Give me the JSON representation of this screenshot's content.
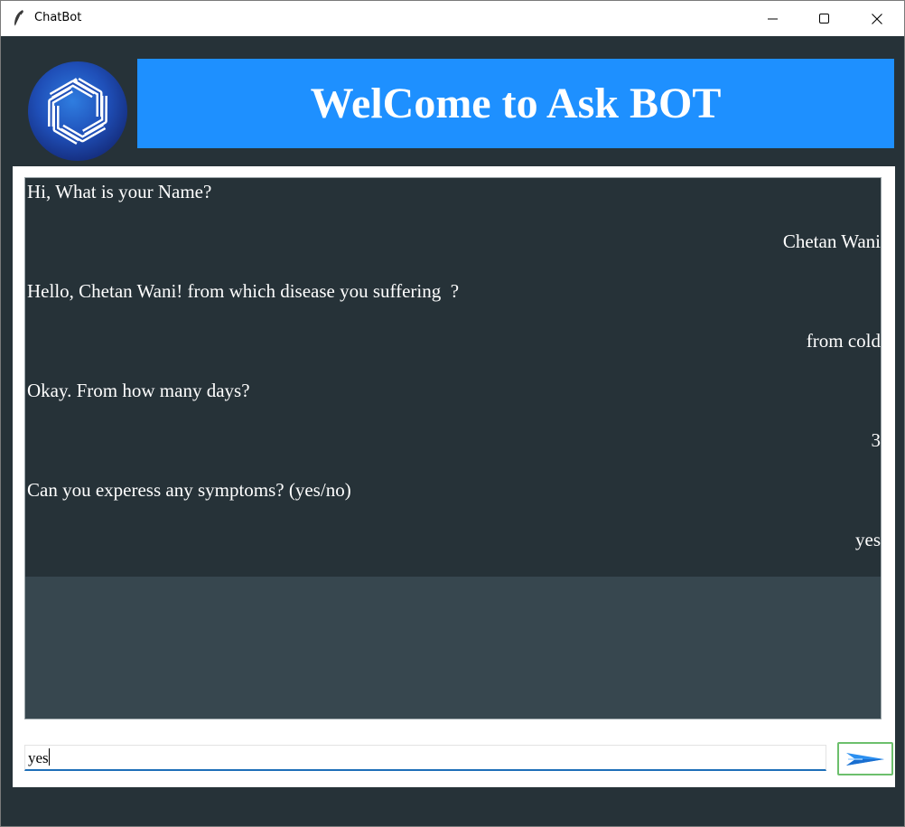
{
  "window": {
    "title": "ChatBot"
  },
  "header": {
    "title": "WelCome to Ask BOT",
    "banner_color": "#1e90ff",
    "logo_icon": "openai-logo-icon"
  },
  "chat": {
    "messages": [
      {
        "sender": "bot",
        "text": "Hi, What is your Name?"
      },
      {
        "sender": "user",
        "text": "Chetan Wani"
      },
      {
        "sender": "bot",
        "text": "Hello, Chetan Wani! from which disease you suffering  ?"
      },
      {
        "sender": "user",
        "text": "from cold"
      },
      {
        "sender": "bot",
        "text": "Okay. From how many days?"
      },
      {
        "sender": "user",
        "text": "3"
      },
      {
        "sender": "bot",
        "text": "Can you experess any symptoms? (yes/no)"
      },
      {
        "sender": "user",
        "text": "yes"
      }
    ]
  },
  "input": {
    "value": "yes",
    "send_icon": "send-arrow-icon"
  },
  "colors": {
    "window_bg": "#263238",
    "chat_bg": "#263238",
    "chat_empty_bg": "#37474f",
    "send_border": "#6cbf6c"
  }
}
